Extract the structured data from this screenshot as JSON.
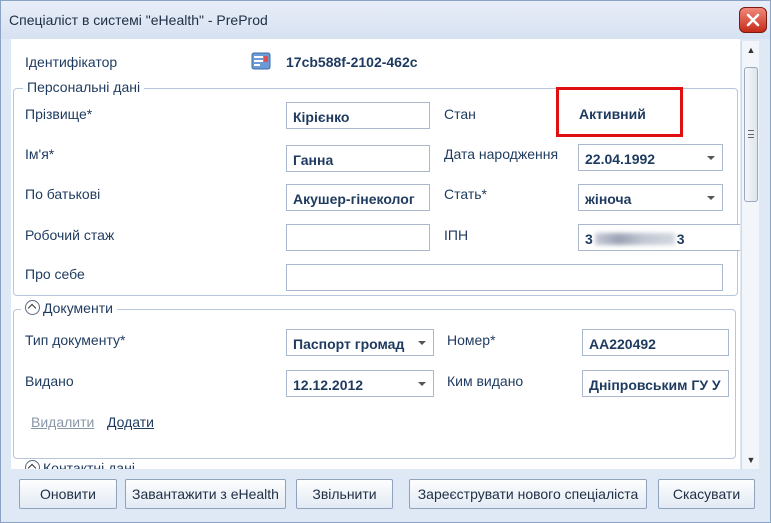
{
  "window": {
    "title": "Спеціаліст в системі \"eHealth\" - PreProd"
  },
  "identifier": {
    "label": "Ідентифікатор",
    "value": "17cb588f-2102-462c",
    "icon": "id-card-icon"
  },
  "personal": {
    "group_title": "Персональні дані",
    "surname_label": "Прізвище*",
    "surname_value": "Кірієнко",
    "name_label": "Ім'я*",
    "name_value": "Ганна",
    "patronymic_label": "По батькові",
    "patronymic_value": "Акушер-гінеколог",
    "experience_label": "Робочий стаж",
    "experience_value": "",
    "about_label": "Про себе",
    "about_value": "",
    "status_label": "Стан",
    "status_value": "Активний",
    "birthdate_label": "Дата народження",
    "birthdate_value": "22.04.1992",
    "gender_label": "Стать*",
    "gender_value": "жіноча",
    "tax_label": "ІПН",
    "tax_value_start": "3",
    "tax_value_end": "3"
  },
  "documents": {
    "group_title": "Документи",
    "type_label": "Тип документу*",
    "type_value": "Паспорт громад",
    "number_label": "Номер*",
    "number_value": "AA220492",
    "issued_label": "Видано",
    "issued_value": "12.12.2012",
    "issued_by_label": "Ким видано",
    "issued_by_value": "Дніпровським ГУ У",
    "delete_link": "Видалити",
    "add_link": "Додати"
  },
  "contacts": {
    "group_title": "Контактні дані"
  },
  "buttons": {
    "refresh": "Оновити",
    "load": "Завантажити з eHealth",
    "dismiss": "Звільнити",
    "register": "Зареєструвати нового спеціаліста",
    "cancel": "Скасувати"
  },
  "colors": {
    "accent_red": "#e01010",
    "text": "#1e3a5f",
    "window_bg": "#dfe8f5"
  }
}
